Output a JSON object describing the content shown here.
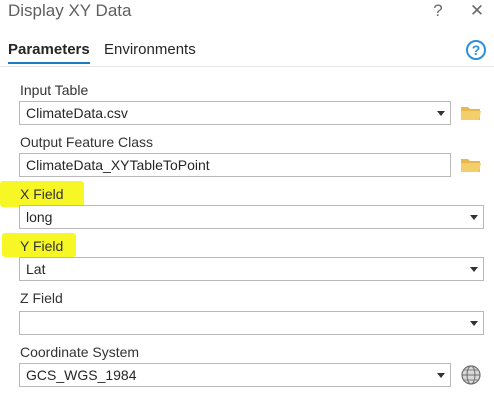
{
  "window": {
    "title": "Display XY Data",
    "help_glyph": "?",
    "close_glyph": "✕"
  },
  "tabs": [
    {
      "label": "Parameters",
      "active": true
    },
    {
      "label": "Environments",
      "active": false
    }
  ],
  "fields": {
    "input_table": {
      "label": "Input Table",
      "value": "ClimateData.csv"
    },
    "output_feature_class": {
      "label": "Output Feature Class",
      "value": "ClimateData_XYTableToPoint"
    },
    "x_field": {
      "label": "X Field",
      "value": "long"
    },
    "y_field": {
      "label": "Y Field",
      "value": "Lat"
    },
    "z_field": {
      "label": "Z Field",
      "value": ""
    },
    "coordinate_system": {
      "label": "Coordinate System",
      "value": "GCS_WGS_1984"
    }
  },
  "colors": {
    "accent": "#1e7bbf",
    "highlight": "#f6f600",
    "folder": "#e8b84a"
  },
  "icons": [
    "help-circle-icon",
    "close-icon",
    "folder-icon",
    "globe-icon",
    "chevron-down-icon"
  ]
}
